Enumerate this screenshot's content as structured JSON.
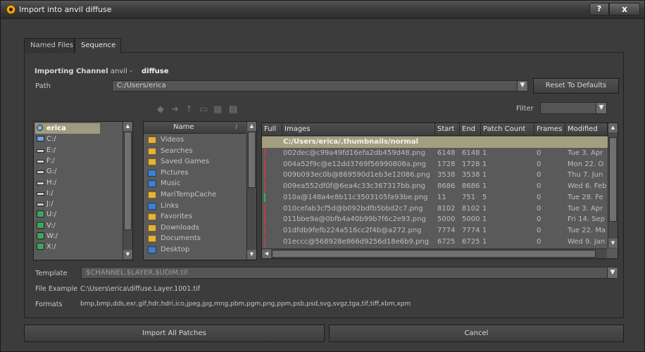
{
  "window": {
    "title": "Import into anvil diffuse",
    "help_label": "?",
    "close_label": "x"
  },
  "tabs": [
    {
      "label": "Named Files"
    },
    {
      "label": "Sequence"
    }
  ],
  "importing": {
    "label": "Importing Channel",
    "channel": "anvil -",
    "name": "diffuse"
  },
  "path": {
    "label": "Path",
    "value": "C:/Users/erica",
    "reset_label": "Reset To Defaults"
  },
  "filter": {
    "label": "Filter",
    "value": ""
  },
  "drives": [
    {
      "label": "erica",
      "icon": "user-folder-icon",
      "selected": true
    },
    {
      "label": "C:/",
      "icon": "computer-drive-icon"
    },
    {
      "label": "E:/",
      "icon": "disk-drive-icon"
    },
    {
      "label": "F:/",
      "icon": "disk-drive-icon"
    },
    {
      "label": "G:/",
      "icon": "disk-drive-icon"
    },
    {
      "label": "H:/",
      "icon": "disk-drive-icon"
    },
    {
      "label": "I:/",
      "icon": "disk-drive-icon"
    },
    {
      "label": "J:/",
      "icon": "disk-drive-icon"
    },
    {
      "label": "U:/",
      "icon": "network-drive-icon"
    },
    {
      "label": "V:/",
      "icon": "network-drive-icon"
    },
    {
      "label": "W:/",
      "icon": "network-drive-icon"
    },
    {
      "label": "X:/",
      "icon": "network-drive-icon"
    }
  ],
  "dirs": {
    "header": "Name",
    "items": [
      {
        "label": "Videos"
      },
      {
        "label": "Searches"
      },
      {
        "label": "Saved Games"
      },
      {
        "label": "Pictures"
      },
      {
        "label": "Music"
      },
      {
        "label": "MariTempCache"
      },
      {
        "label": "Links"
      },
      {
        "label": "Favorites"
      },
      {
        "label": "Downloads"
      },
      {
        "label": "Documents"
      },
      {
        "label": "Desktop"
      }
    ]
  },
  "images": {
    "headers": {
      "full": "Full",
      "images": "Images",
      "start": "Start",
      "end": "End",
      "patch_count": "Patch Count",
      "frames": "Frames",
      "modified": "Modified"
    },
    "folder": "C:/Users/erica/.thumbnails/normal",
    "rows": [
      {
        "name": "002dec@c99a49fd16efa2db459d48.png",
        "start": "6148",
        "end": "6148",
        "patch": "1",
        "frames": "0",
        "modified": "Tue 3. Apr",
        "mark": "red"
      },
      {
        "name": "004a52f9c@e12dd3769f56990808a.png",
        "start": "1728",
        "end": "1728",
        "patch": "1",
        "frames": "0",
        "modified": "Mon 22. O",
        "mark": "red"
      },
      {
        "name": "009b093ec0b@869590d1eb3e12086.png",
        "start": "3538",
        "end": "3538",
        "patch": "1",
        "frames": "0",
        "modified": "Thu 7. Jun",
        "mark": "red"
      },
      {
        "name": "009ea552df0f@6ea4c33c367317bb.png",
        "start": "8686",
        "end": "8686",
        "patch": "1",
        "frames": "0",
        "modified": "Wed 6. Feb",
        "mark": "red"
      },
      {
        "name": "010a@148a4e8b11c3503105fa93be.png",
        "start": "11",
        "end": "751",
        "patch": "5",
        "frames": "0",
        "modified": "Tue 28. Fe",
        "mark": "green"
      },
      {
        "name": "010cefab3cf5d@b092bdfb5bbd2c7.png",
        "start": "8102",
        "end": "8102",
        "patch": "1",
        "frames": "0",
        "modified": "Tue 3. Apr",
        "mark": "red"
      },
      {
        "name": "011bbe9a@0bfb4a40b99b7f6c2e93.png",
        "start": "5000",
        "end": "5000",
        "patch": "1",
        "frames": "0",
        "modified": "Fri 14. Sep",
        "mark": "red"
      },
      {
        "name": "01dfdb9fefb224a516cc2f4b@a272.png",
        "start": "7774",
        "end": "7774",
        "patch": "1",
        "frames": "0",
        "modified": "Tue 22. Ma",
        "mark": "red"
      },
      {
        "name": "01eccc@568928e866d9256d18e6b9.png",
        "start": "6725",
        "end": "6725",
        "patch": "1",
        "frames": "0",
        "modified": "Wed 9. Jan",
        "mark": "red"
      }
    ]
  },
  "template": {
    "label": "Template",
    "value": "$CHANNEL.$LAYER.$UDIM.tif"
  },
  "file_example": {
    "label": "File Example",
    "value": "C:\\Users\\erica\\diffuse.Layer.1001.tif"
  },
  "formats": {
    "label": "Formats",
    "value": "bmp,bmp,dds,exr,gif,hdr,hdri,ico,jpeg,jpg,mng,pbm,pgm,png,ppm,psb,psd,svg,svgz,tga,tif,tiff,xbm,xpm"
  },
  "buttons": {
    "import_label": "Import All Patches",
    "cancel_label": "Cancel"
  },
  "toolbar_icons": [
    "back-arrow-icon",
    "forward-arrow-icon",
    "up-arrow-icon",
    "folder-view-icon",
    "grid-view-icon",
    "list-view-icon"
  ]
}
